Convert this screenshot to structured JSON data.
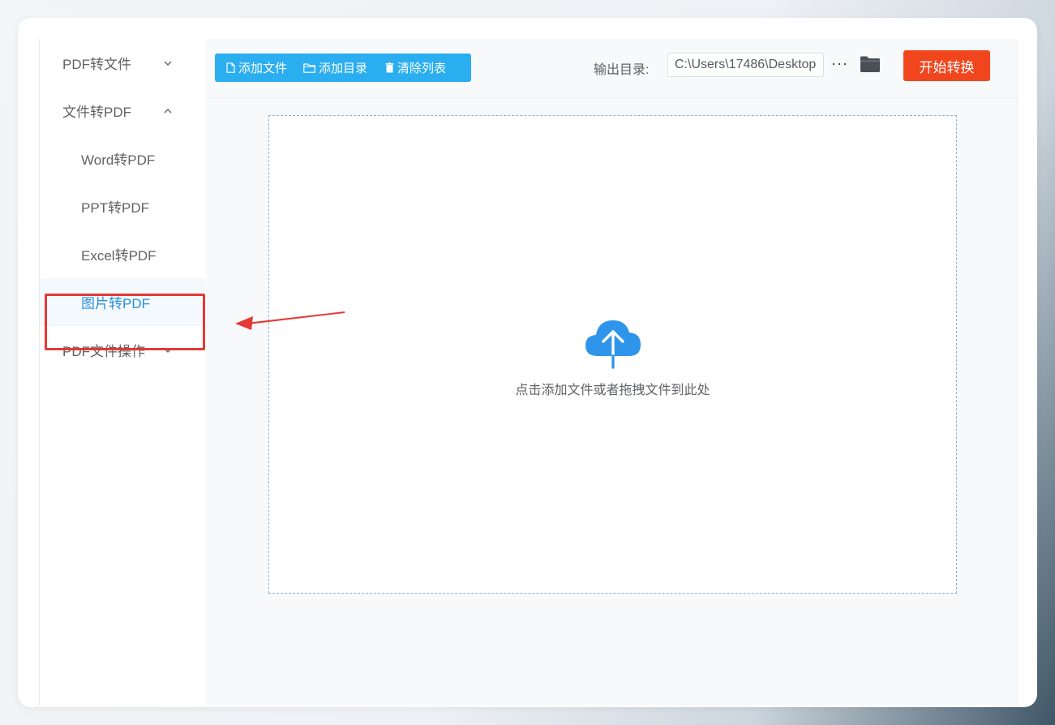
{
  "sidebar": {
    "groups": [
      {
        "label": "PDF转文件",
        "expanded": false
      },
      {
        "label": "文件转PDF",
        "expanded": true,
        "items": [
          {
            "label": "Word转PDF"
          },
          {
            "label": "PPT转PDF"
          },
          {
            "label": "Excel转PDF"
          },
          {
            "label": "图片转PDF",
            "active": true
          }
        ]
      },
      {
        "label": "PDF文件操作",
        "expanded": false
      }
    ]
  },
  "toolbar": {
    "add_file_label": "添加文件",
    "add_folder_label": "添加目录",
    "clear_list_label": "清除列表",
    "output_label": "输出目录:",
    "output_path": "C:\\Users\\17486\\Desktop",
    "more_label": "···",
    "start_label": "开始转换"
  },
  "dropzone": {
    "hint": "点击添加文件或者拖拽文件到此处"
  },
  "colors": {
    "accent_blue": "#2aaef0",
    "start_orange": "#f1461d",
    "active_text": "#2f8fd8",
    "annotation_red": "#e53935",
    "cloud_blue": "#2f95ea"
  },
  "icons": [
    "chevron-down-icon",
    "chevron-up-icon",
    "file-icon",
    "folder-outline-icon",
    "trash-icon",
    "folder-icon",
    "cloud-upload-icon",
    "arrow-annotation"
  ]
}
